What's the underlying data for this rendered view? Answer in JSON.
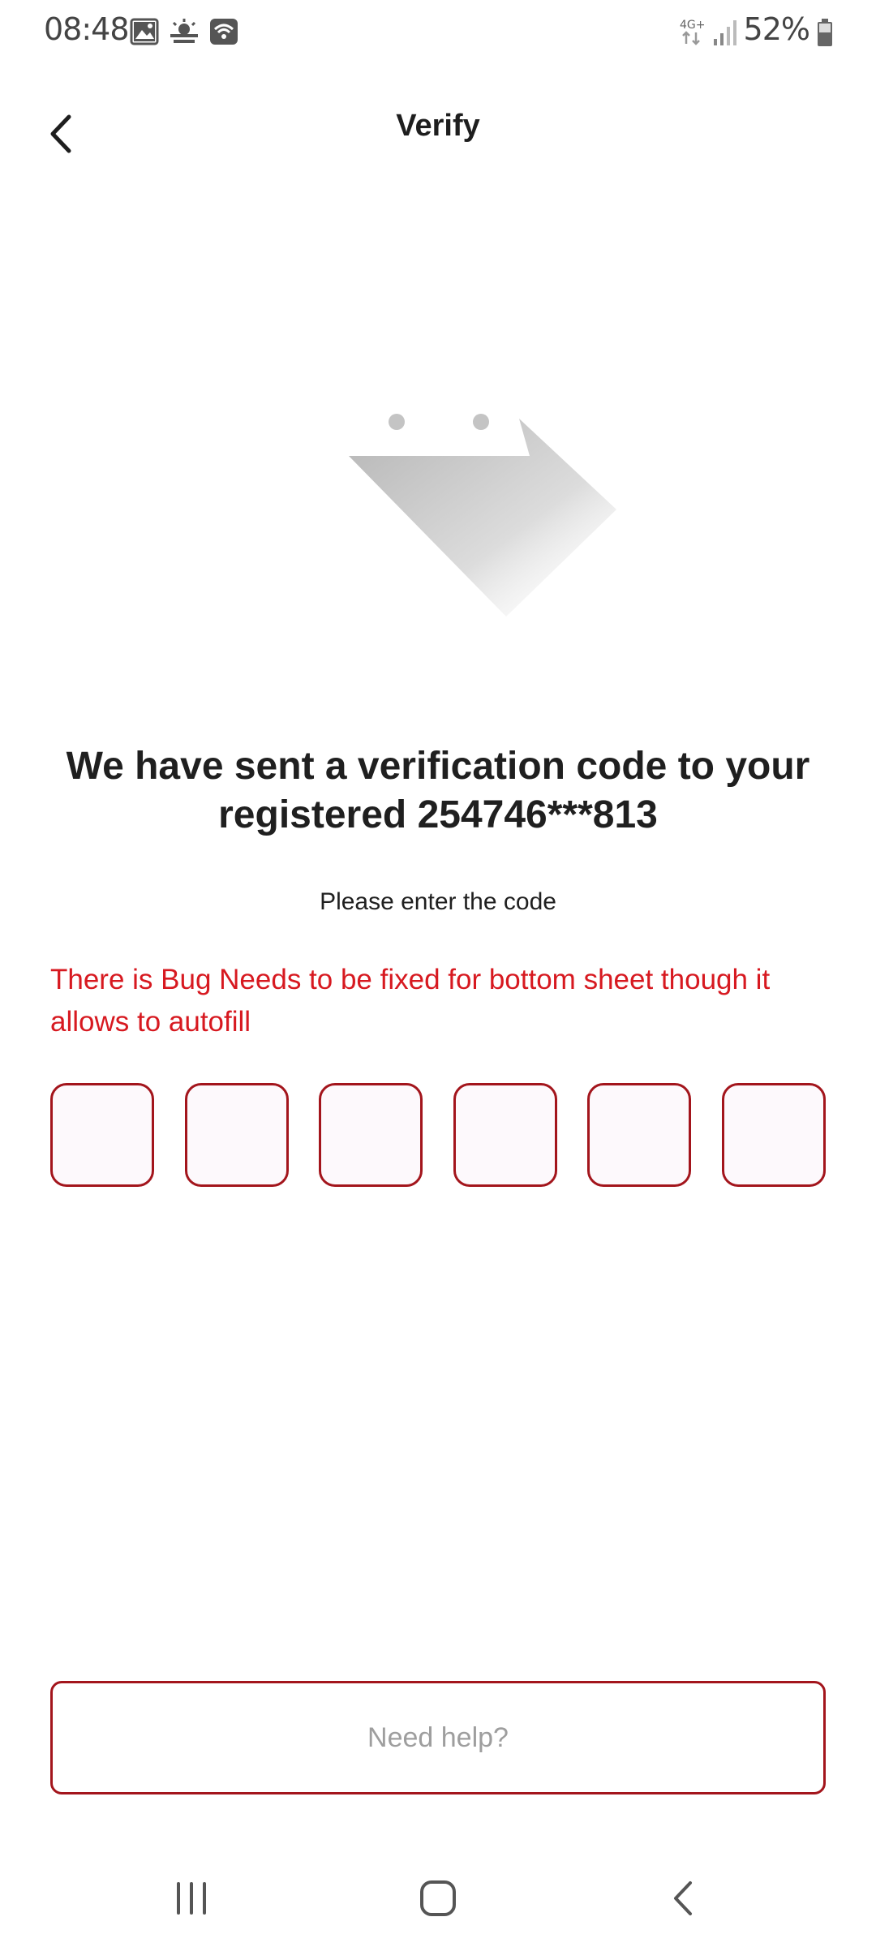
{
  "status_bar": {
    "time": "08:48",
    "battery": "52%",
    "network": "4G+",
    "icons": [
      "image-icon",
      "weather-icon",
      "wifi-icon",
      "network-4g-icon",
      "signal-icon",
      "battery-icon"
    ]
  },
  "header": {
    "title": "Verify",
    "back_icon": "chevron-left-icon"
  },
  "main": {
    "message": "We have sent a verification code to your registered 254746***813",
    "instruction": "Please enter the code",
    "bug_note": "There is Bug Needs to be fixed for bottom sheet though it allows to autofill",
    "otp": {
      "length": 6,
      "values": [
        "",
        "",
        "",
        "",
        "",
        ""
      ]
    }
  },
  "footer": {
    "help_label": "Need help?"
  },
  "nav_bar": {
    "icons": [
      "recents-icon",
      "home-icon",
      "back-icon"
    ]
  },
  "colors": {
    "accent": "#a3151c",
    "error_text": "#d71920",
    "otp_fill": "#fdf9fc",
    "muted_text": "#9e9e9e"
  }
}
